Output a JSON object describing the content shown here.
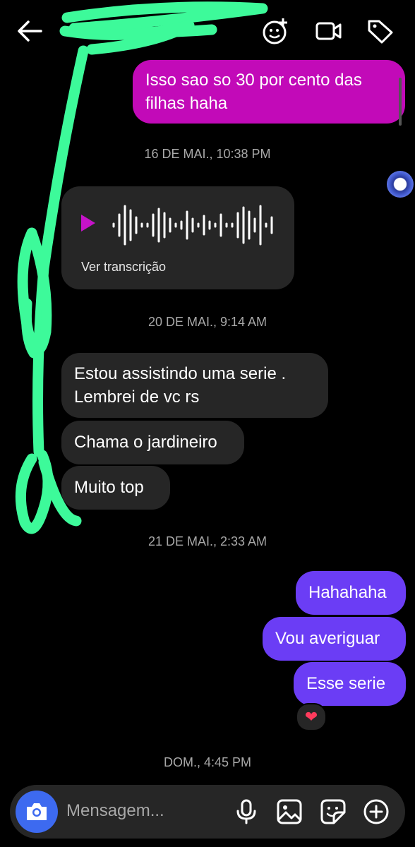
{
  "messages": {
    "m1": "Isso sao so 30 por cento das filhas haha",
    "m1_line1": "Isso sao so 30 por cento das",
    "m1_line2": "filhas haha",
    "ts1": "16 DE MAI., 10:38 PM",
    "voice_transcript_label": "Ver transcrição",
    "ts2": "20 DE MAI., 9:14 AM",
    "m2_line1": "Estou assistindo uma serie .",
    "m2_line2": "Lembrei de vc rs",
    "m3": "Chama o jardineiro",
    "m4": "Muito top",
    "ts3": "21 DE MAI., 2:33 AM",
    "m5": "Hahahaha",
    "m6": "Vou averiguar",
    "m7": "Esse serie",
    "reaction": "❤",
    "ts4": "DOM., 4:45 PM"
  },
  "composer": {
    "placeholder": "Mensagem..."
  },
  "colors": {
    "outgoing_pink": "#c20ab8",
    "outgoing_purple": "#6b3df5",
    "incoming": "#262626",
    "camera_button": "#3d6af0",
    "scribble": "#3dfa9a"
  },
  "icons": [
    "back-arrow-icon",
    "effects-icon",
    "video-call-icon",
    "tag-icon",
    "play-icon",
    "camera-icon",
    "microphone-icon",
    "gallery-icon",
    "sticker-icon",
    "add-icon"
  ]
}
